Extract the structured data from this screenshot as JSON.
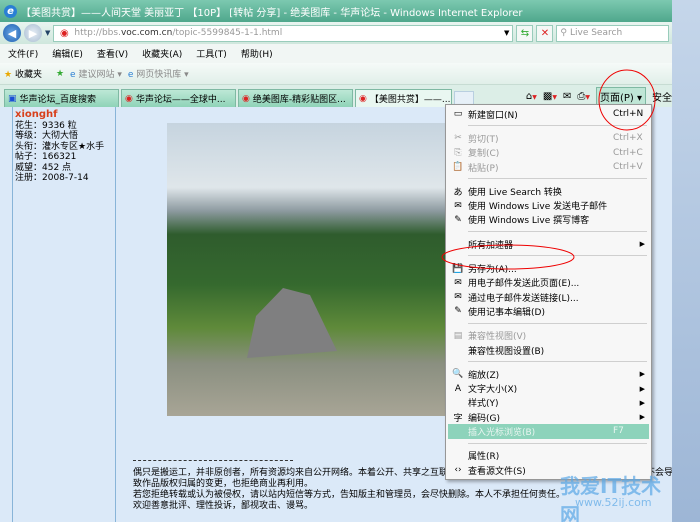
{
  "window": {
    "title": "【美图共赏】——人间天堂 美丽亚丁 【10P】 [转帖 分享] - 绝美图库 - 华声论坛 - Windows Internet Explorer"
  },
  "address": {
    "url_prefix": "http://bbs.",
    "url_domain": "voc.com.cn",
    "url_path": "/topic-5599845-1-1.html",
    "search_placeholder": "Live Search"
  },
  "menubar": [
    "文件(F)",
    "编辑(E)",
    "查看(V)",
    "收藏夹(A)",
    "工具(T)",
    "帮助(H)"
  ],
  "favorites": {
    "label": "收藏夹",
    "items": [
      "建议网站 ▾",
      "网页快讯库 ▾"
    ]
  },
  "tabs": [
    {
      "label": "华声论坛_百度搜索"
    },
    {
      "label": "华声论坛——全球中..."
    },
    {
      "label": "绝美图库-精彩贴图区..."
    },
    {
      "label": "【美图共赏】——...",
      "active": true
    }
  ],
  "commandbar": {
    "page": "页面(P) ▾",
    "safety": "安全"
  },
  "user": {
    "name": "xionghf",
    "lines": [
      "花生：9336 粒",
      "等级：大彻大悟",
      "头衔：灌水专区★水手",
      "帖子：166321",
      "威望：452 点",
      "注册：2008-7-14"
    ]
  },
  "notice": {
    "rule": "--------------------------------------------------------",
    "lines": [
      "偶只是搬运工，并非原创者，所有资源均来自公开网络。本着公开、共享之互联网精神，按照论坛要求，仅供学习、交流与娱乐，不会导致作品版权归属的变更，也拒绝商业再利用。",
      "若您拒绝转载或认为被侵权，请以站内短信等方式，告知版主和管理员，会尽快删除。本人不承担任何责任。",
      "欢迎善意批评、理性投诉，鄙视攻击、谩骂。"
    ]
  },
  "menu": {
    "groups": [
      [
        {
          "label": "新建窗口(N)",
          "shortcut": "Ctrl+N",
          "icon": "▭"
        }
      ],
      [
        {
          "label": "剪切(T)",
          "shortcut": "Ctrl+X",
          "icon": "✂",
          "disabled": true
        },
        {
          "label": "复制(C)",
          "shortcut": "Ctrl+C",
          "icon": "⎘",
          "disabled": true
        },
        {
          "label": "粘贴(P)",
          "shortcut": "Ctrl+V",
          "icon": "📋",
          "disabled": true
        }
      ],
      [
        {
          "label": "使用 Live Search 转换",
          "icon": "あ"
        },
        {
          "label": "使用 Windows Live 发送电子邮件",
          "icon": "✉"
        },
        {
          "label": "使用 Windows Live 撰写博客",
          "icon": "✎"
        }
      ],
      [
        {
          "label": "所有加速器",
          "submenu": true
        }
      ],
      [
        {
          "label": "另存为(A)...",
          "icon": "💾"
        },
        {
          "label": "用电子邮件发送此页面(E)...",
          "icon": "✉"
        },
        {
          "label": "通过电子邮件发送链接(L)...",
          "icon": "✉"
        },
        {
          "label": "使用记事本编辑(D)",
          "icon": "✎"
        }
      ],
      [
        {
          "label": "兼容性视图(V)",
          "icon": "▤",
          "disabled": true
        },
        {
          "label": "兼容性视图设置(B)"
        }
      ],
      [
        {
          "label": "缩放(Z)",
          "icon": "🔍",
          "submenu": true
        },
        {
          "label": "文字大小(X)",
          "icon": "A",
          "submenu": true
        },
        {
          "label": "样式(Y)",
          "submenu": true
        },
        {
          "label": "编码(G)",
          "icon": "字",
          "submenu": true
        },
        {
          "label": "插入光标浏览(B)",
          "shortcut": "F7",
          "highlighted": true
        }
      ],
      [
        {
          "label": "属性(R)"
        },
        {
          "label": "查看源文件(S)",
          "icon": "‹›"
        }
      ]
    ]
  },
  "watermark": {
    "text": "我爱IT技术网",
    "url": "www.52ij.com"
  }
}
